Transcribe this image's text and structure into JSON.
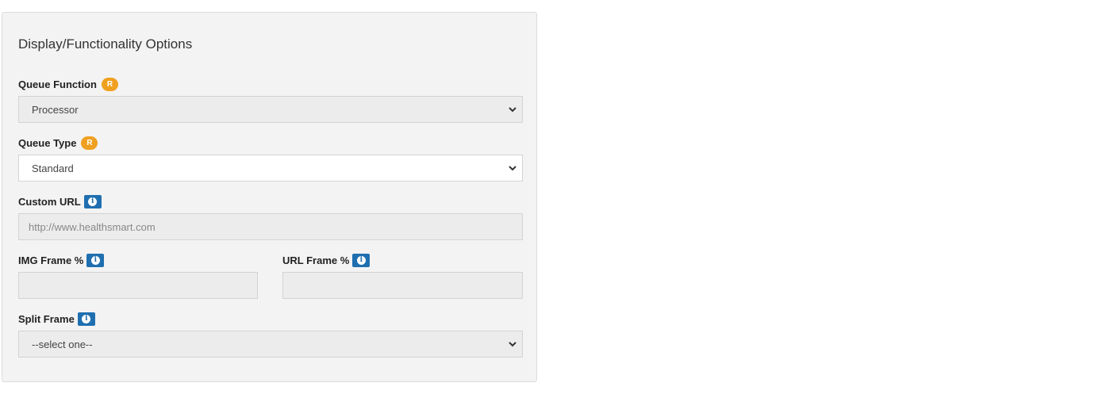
{
  "panel": {
    "title": "Display/Functionality Options"
  },
  "fields": {
    "queue_function": {
      "label": "Queue Function",
      "badge": "R",
      "value": "Processor"
    },
    "queue_type": {
      "label": "Queue Type",
      "badge": "R",
      "value": "Standard"
    },
    "custom_url": {
      "label": "Custom URL",
      "info": "i",
      "value": "http://www.healthsmart.com"
    },
    "img_frame": {
      "label": "IMG Frame %",
      "info": "i",
      "value": ""
    },
    "url_frame": {
      "label": "URL Frame %",
      "info": "i",
      "value": ""
    },
    "split_frame": {
      "label": "Split Frame",
      "info": "i",
      "value": "--select one--"
    }
  },
  "colors": {
    "required_badge": "#f0a020",
    "info_badge": "#1f6fb0",
    "panel_bg": "#f3f3f3"
  }
}
